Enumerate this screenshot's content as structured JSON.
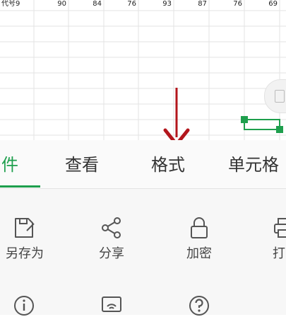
{
  "header_row": {
    "label": "代号9",
    "values": [
      "90",
      "84",
      "76",
      "93",
      "87",
      "76",
      "69"
    ]
  },
  "tabs": [
    {
      "label": "件",
      "active": true
    },
    {
      "label": "查看",
      "active": false
    },
    {
      "label": "格式",
      "active": false
    },
    {
      "label": "单元格",
      "active": false
    }
  ],
  "actions_row1": [
    {
      "label": "另存为",
      "icon": "save-as-icon"
    },
    {
      "label": "分享",
      "icon": "share-icon"
    },
    {
      "label": "加密",
      "icon": "lock-icon"
    },
    {
      "label": "打",
      "icon": "print-icon"
    }
  ],
  "actions_row2": [
    {
      "icon": "info-icon"
    },
    {
      "icon": "cast-icon"
    },
    {
      "icon": "help-icon"
    }
  ],
  "colors": {
    "accent": "#1e9f4d",
    "arrow": "#b3161c",
    "grid": "#e3e3e3"
  }
}
